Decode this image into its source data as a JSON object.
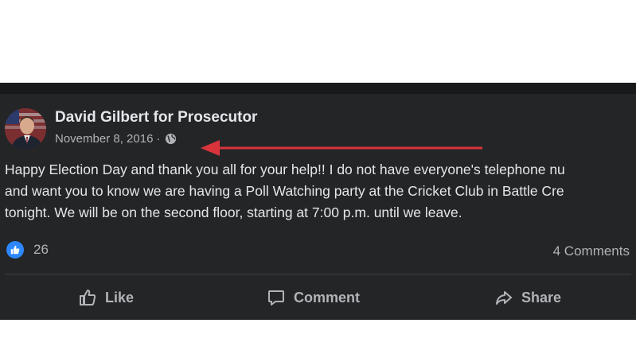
{
  "post": {
    "author": "David Gilbert for Prosecutor",
    "date": "November 8, 2016",
    "separator": "·",
    "privacy_icon": "globe-icon",
    "body_lines": [
      "Happy Election Day and thank you all for your help!! I do not have everyone's telephone nu",
      "and want you to know we are having a Poll Watching party at the Cricket Club in Battle Cre",
      "tonight. We will be on the second floor, starting at 7:00 p.m. until we leave."
    ],
    "reactions_count": "26",
    "comments_count": "4 Comments",
    "actions": {
      "like": "Like",
      "comment": "Comment",
      "share": "Share"
    }
  },
  "annotation": {
    "arrow_color": "#d9343b"
  },
  "colors": {
    "card_bg": "#242526",
    "text_primary": "#e4e6eb",
    "text_secondary": "#b0b3b8",
    "like_blue": "#2d88ff"
  }
}
